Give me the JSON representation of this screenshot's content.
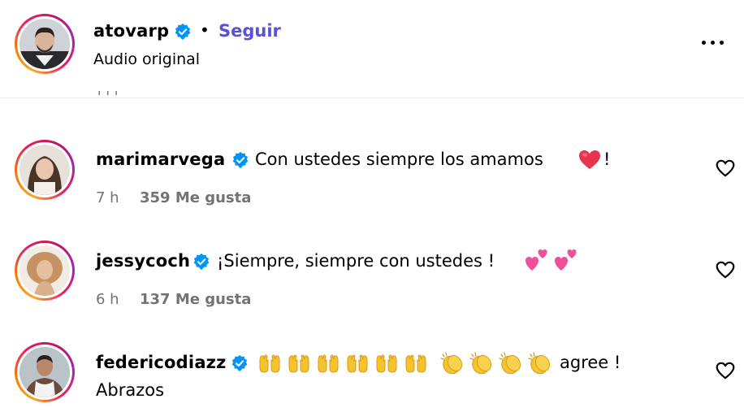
{
  "post_header": {
    "username": "atovarp",
    "separator": "•",
    "follow_label": "Seguir",
    "subtitle": "Audio original"
  },
  "comments": [
    {
      "username": "marimarvega",
      "text_before": "Con ustedes siempre los amamos",
      "text_after": "!",
      "time": "7 h",
      "likes": "359 Me gusta"
    },
    {
      "username": "jessycoch",
      "text_before": "¡Siempre, siempre con ustedes !",
      "time": "6 h",
      "likes": "137 Me gusta"
    },
    {
      "username": "federicodiazz",
      "text_after": "agree !",
      "second_line": "Abrazos"
    }
  ],
  "icons": {
    "verified": "verified-badge-icon",
    "more": "more-options-icon",
    "like": "heart-outline-icon",
    "emoji_heart": "red-heart-emoji",
    "emoji_two_hearts": "two-hearts-emoji",
    "emoji_raised_hands": "raising-hands-emoji",
    "emoji_clap": "clapping-hands-emoji"
  },
  "colors": {
    "follow": "#5b51d8",
    "verified": "#0095f6",
    "muted_text": "#737373",
    "divider": "#efefef"
  }
}
